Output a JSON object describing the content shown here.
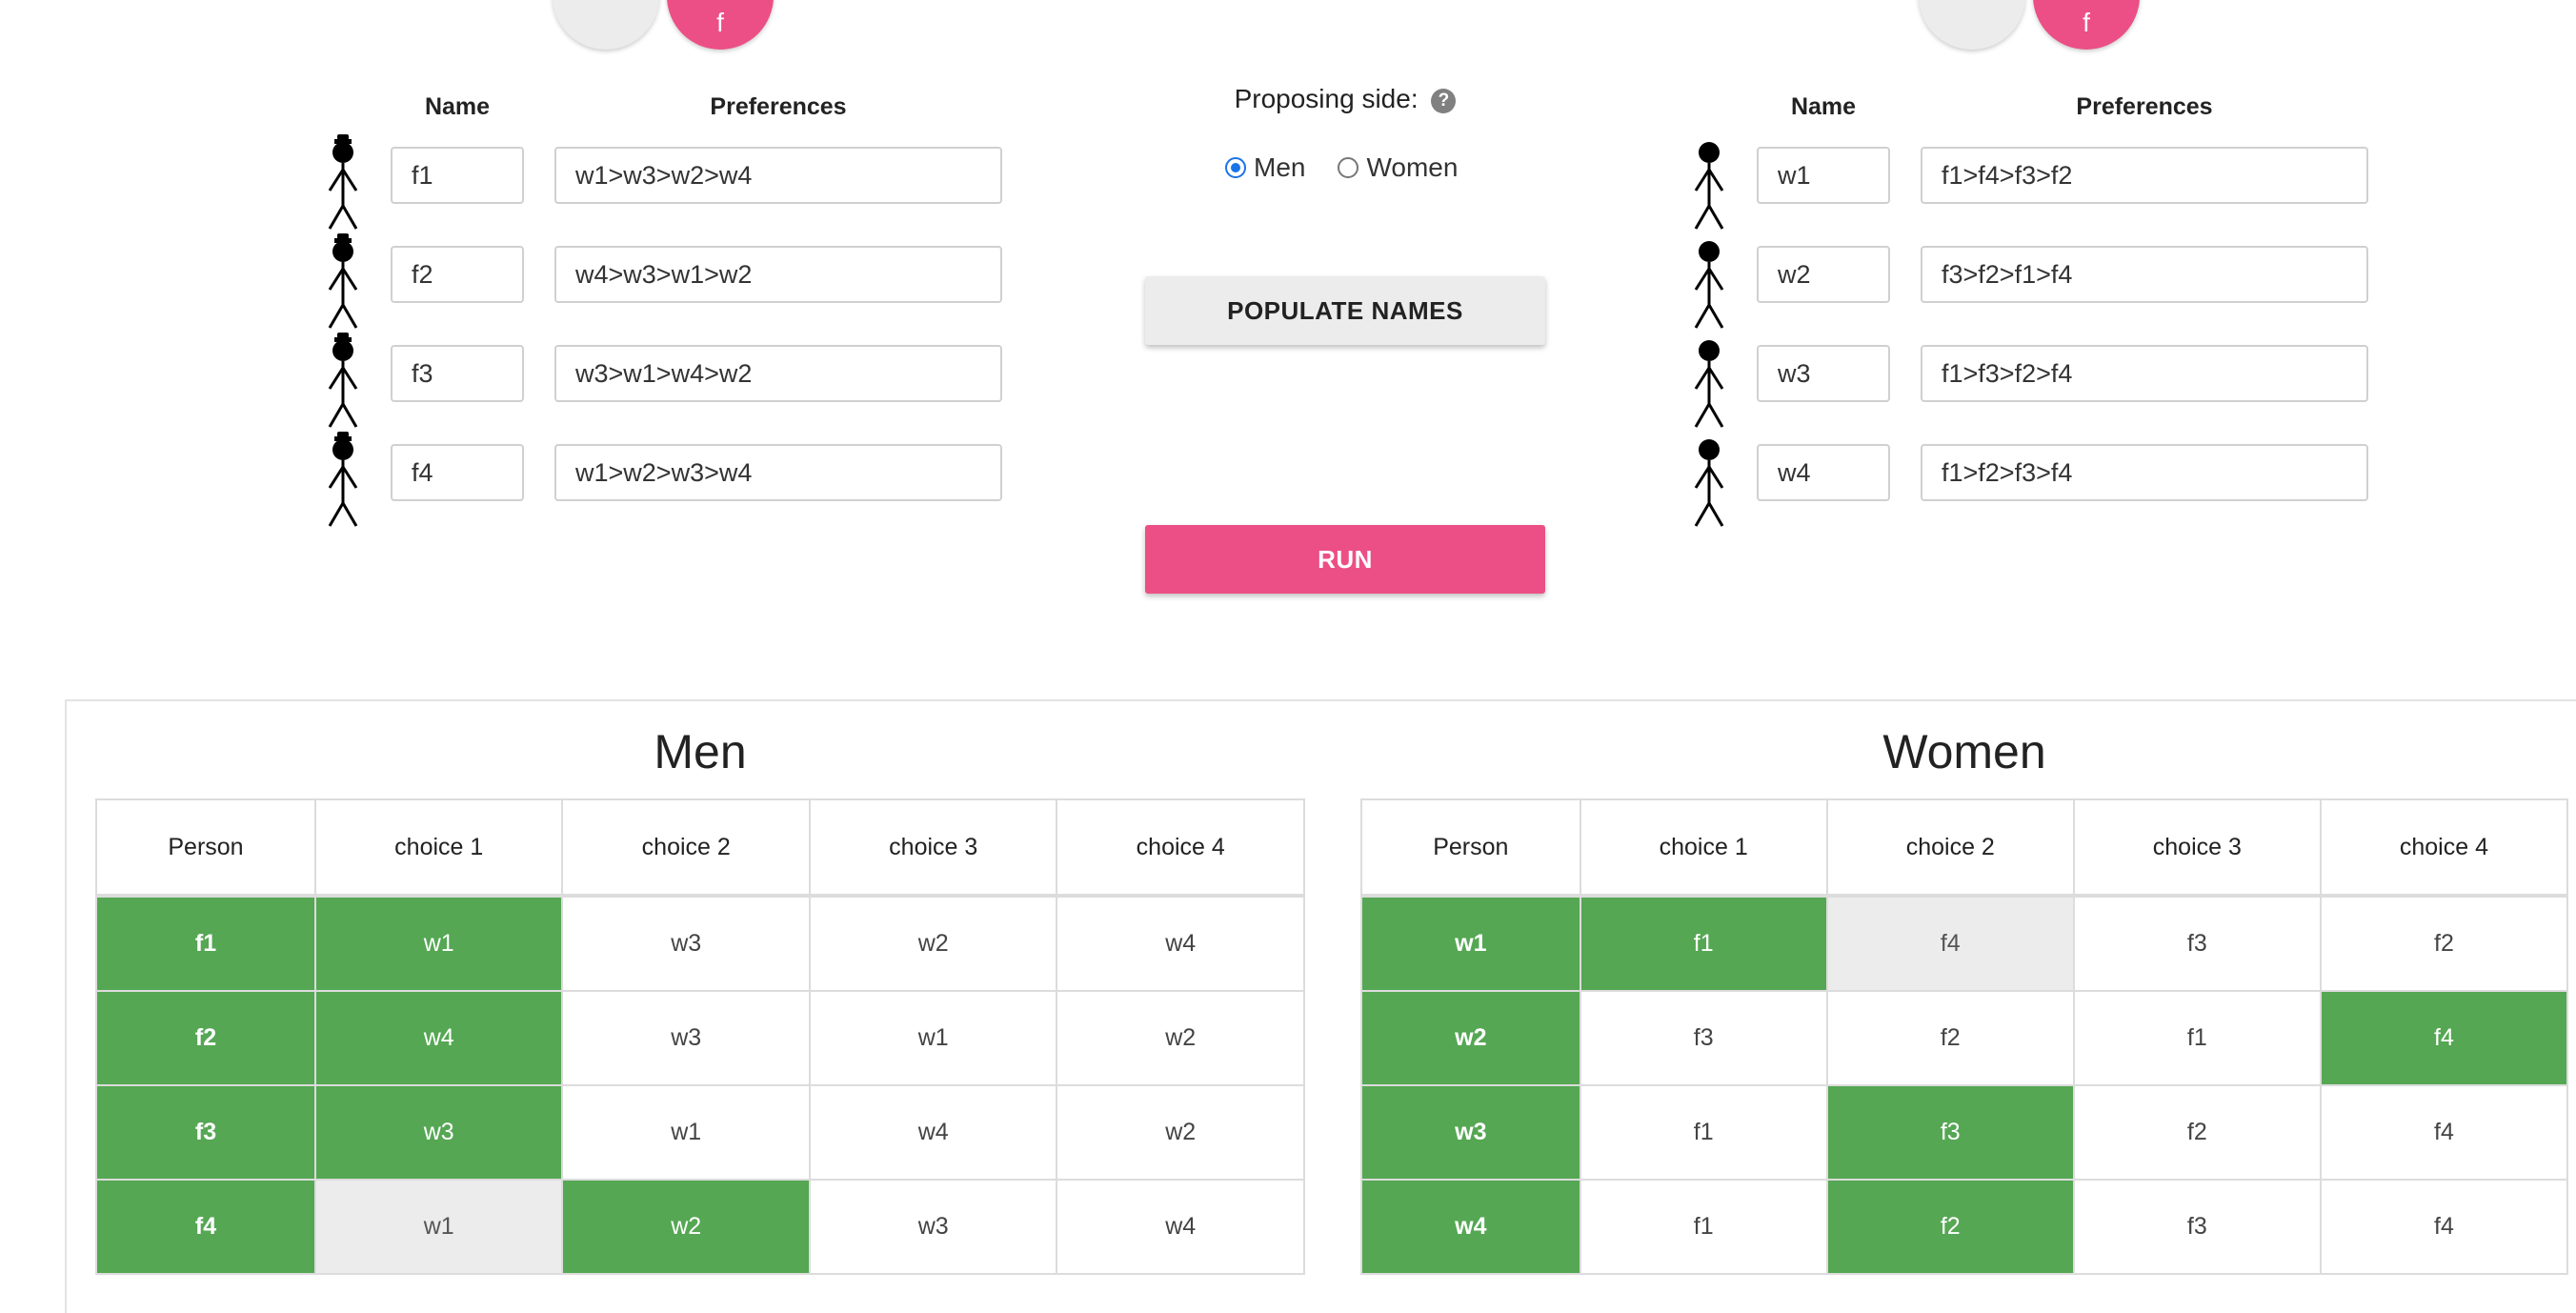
{
  "top_circles": {
    "left_pair_label": "f",
    "right_pair_label": "f"
  },
  "form": {
    "name_header": "Name",
    "preferences_header": "Preferences"
  },
  "men_inputs": [
    {
      "name": "f1",
      "prefs": "w1>w3>w2>w4"
    },
    {
      "name": "f2",
      "prefs": "w4>w3>w1>w2"
    },
    {
      "name": "f3",
      "prefs": "w3>w1>w4>w2"
    },
    {
      "name": "f4",
      "prefs": "w1>w2>w3>w4"
    }
  ],
  "women_inputs": [
    {
      "name": "w1",
      "prefs": "f1>f4>f3>f2"
    },
    {
      "name": "w2",
      "prefs": "f3>f2>f1>f4"
    },
    {
      "name": "w3",
      "prefs": "f1>f3>f2>f4"
    },
    {
      "name": "w4",
      "prefs": "f1>f2>f3>f4"
    }
  ],
  "controls": {
    "proposing_label": "Proposing side:",
    "help_glyph": "?",
    "options": [
      "Men",
      "Women"
    ],
    "selected": "Men",
    "populate_label": "POPULATE NAMES",
    "run_label": "RUN"
  },
  "results": {
    "men": {
      "title": "Men",
      "headers": [
        "Person",
        "choice 1",
        "choice 2",
        "choice 3",
        "choice 4"
      ],
      "rows": [
        {
          "person": "f1",
          "choices": [
            "w1",
            "w3",
            "w2",
            "w4"
          ],
          "states": [
            "matched",
            "",
            "",
            ""
          ]
        },
        {
          "person": "f2",
          "choices": [
            "w4",
            "w3",
            "w1",
            "w2"
          ],
          "states": [
            "matched",
            "",
            "",
            ""
          ]
        },
        {
          "person": "f3",
          "choices": [
            "w3",
            "w1",
            "w4",
            "w2"
          ],
          "states": [
            "matched",
            "",
            "",
            ""
          ]
        },
        {
          "person": "f4",
          "choices": [
            "w1",
            "w2",
            "w3",
            "w4"
          ],
          "states": [
            "rejected",
            "matched",
            "",
            ""
          ]
        }
      ]
    },
    "women": {
      "title": "Women",
      "headers": [
        "Person",
        "choice 1",
        "choice 2",
        "choice 3",
        "choice 4"
      ],
      "rows": [
        {
          "person": "w1",
          "choices": [
            "f1",
            "f4",
            "f3",
            "f2"
          ],
          "states": [
            "matched",
            "rejected",
            "",
            ""
          ]
        },
        {
          "person": "w2",
          "choices": [
            "f3",
            "f2",
            "f1",
            "f4"
          ],
          "states": [
            "",
            "",
            "",
            "matched"
          ]
        },
        {
          "person": "w3",
          "choices": [
            "f1",
            "f3",
            "f2",
            "f4"
          ],
          "states": [
            "",
            "matched",
            "",
            ""
          ]
        },
        {
          "person": "w4",
          "choices": [
            "f1",
            "f2",
            "f3",
            "f4"
          ],
          "states": [
            "",
            "matched",
            "",
            ""
          ]
        }
      ]
    }
  },
  "colors": {
    "accent_pink": "#ec4f85",
    "match_green": "#55a753",
    "rejected_grey": "#ececec",
    "radio_blue": "#1a73e8"
  }
}
